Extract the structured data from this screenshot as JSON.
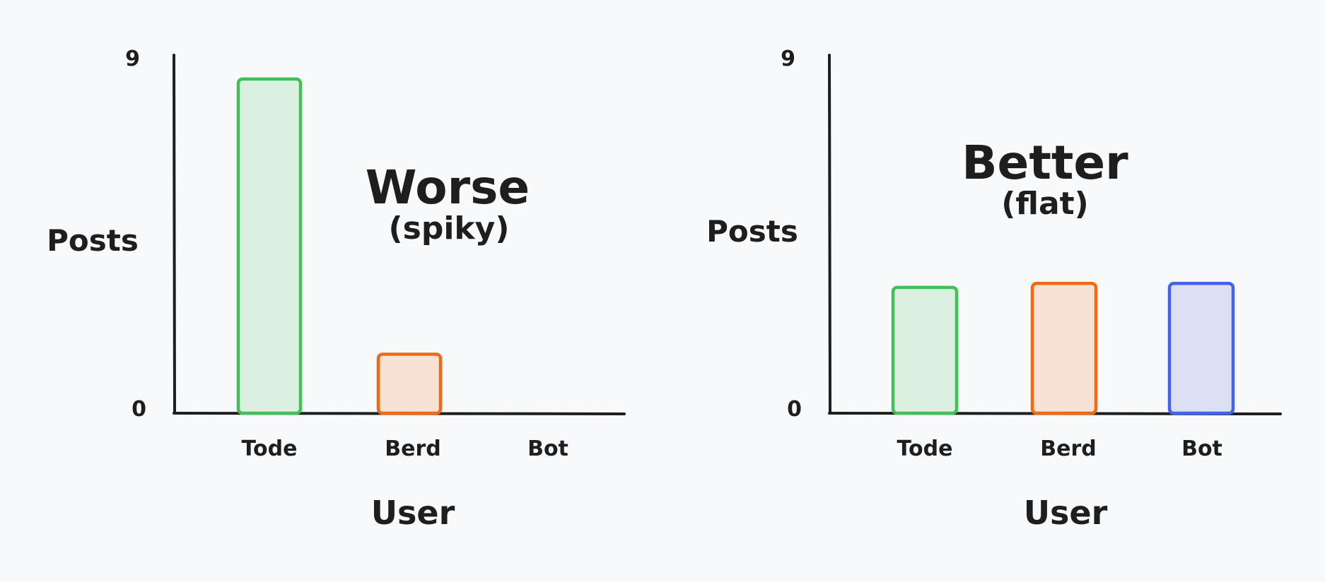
{
  "chart_data": [
    {
      "type": "bar",
      "title": "Worse",
      "subtitle": "(spiky)",
      "xlabel": "User",
      "ylabel": "Posts",
      "categories": [
        "Tode",
        "Berd",
        "Bot"
      ],
      "values": [
        8.5,
        1.5,
        0
      ],
      "ylim": [
        0,
        9
      ],
      "ytick_labels": [
        "0",
        "9"
      ],
      "colors": {
        "Tode": {
          "stroke": "#40c057",
          "fill": "#dbf0e0"
        },
        "Berd": {
          "stroke": "#f06a13",
          "fill": "#f7e2d5"
        },
        "Bot": {
          "stroke": "#4263eb",
          "fill": "#dde0f5"
        }
      },
      "grid": false
    },
    {
      "type": "bar",
      "title": "Better",
      "subtitle": "(flat)",
      "xlabel": "User",
      "ylabel": "Posts",
      "categories": [
        "Tode",
        "Berd",
        "Bot"
      ],
      "values": [
        3.2,
        3.3,
        3.3
      ],
      "ylim": [
        0,
        9
      ],
      "ytick_labels": [
        "0",
        "9"
      ],
      "colors": {
        "Tode": {
          "stroke": "#40c057",
          "fill": "#dbf0e0"
        },
        "Berd": {
          "stroke": "#f06a13",
          "fill": "#f7e2d5"
        },
        "Bot": {
          "stroke": "#4263eb",
          "fill": "#dde0f5"
        }
      },
      "grid": false
    }
  ]
}
